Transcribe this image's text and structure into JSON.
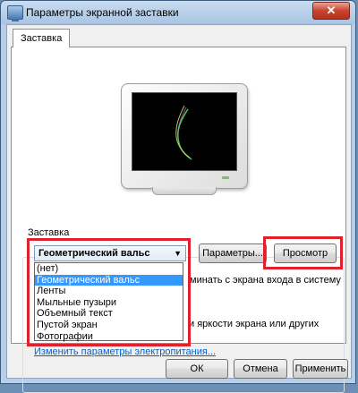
{
  "window": {
    "title": "Параметры экранной заставки",
    "close_glyph": "✕"
  },
  "tabs": [
    {
      "label": "Заставка"
    }
  ],
  "screensaver": {
    "group_label": "Заставка",
    "selected": "Геометрический вальс",
    "options": [
      "(нет)",
      "Геометрический вальс",
      "Ленты",
      "Мыльные пузыри",
      "Объемный текст",
      "Пустой экран",
      "Фотографии"
    ],
    "settings_button": "Параметры...",
    "preview_button": "Просмотр",
    "resume_text_fragment": "минать с экрана входа в систему"
  },
  "power": {
    "text_fragment": "и яркости экрана или других",
    "link": "Изменить параметры электропитания..."
  },
  "footer": {
    "ok": "ОК",
    "cancel": "Отмена",
    "apply": "Применить"
  },
  "colors": {
    "highlight_box": "#e0202a",
    "selection": "#3399ff",
    "link": "#0066cc"
  },
  "icons": {
    "title": "display-settings-icon",
    "close": "close-icon",
    "combo_arrow": "chevron-down-icon"
  }
}
